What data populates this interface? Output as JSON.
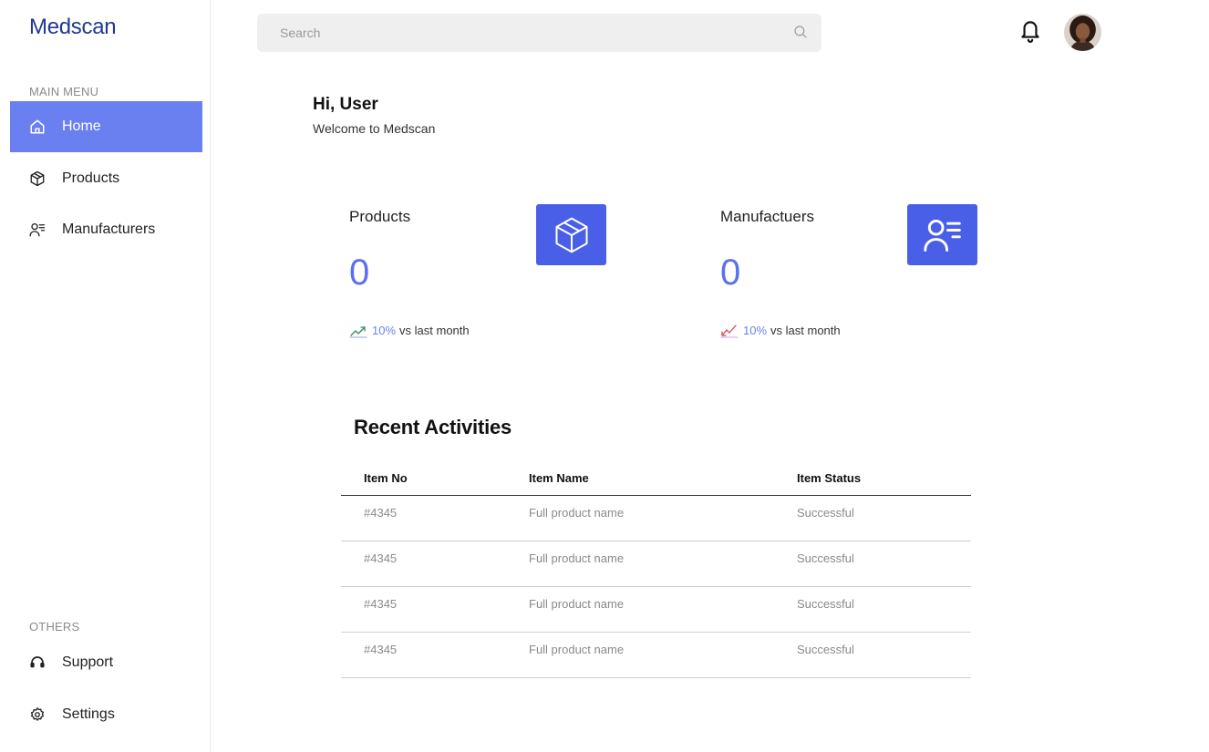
{
  "app": {
    "name": "Medscan"
  },
  "sidebar": {
    "main_heading": "MAIN MENU",
    "items": [
      {
        "label": "Home",
        "icon": "home-icon",
        "active": true
      },
      {
        "label": "Products",
        "icon": "box-icon",
        "active": false
      },
      {
        "label": "Manufacturers",
        "icon": "user-list-icon",
        "active": false
      }
    ],
    "others_heading": "OTHERS",
    "other_items": [
      {
        "label": "Support",
        "icon": "headset-icon"
      },
      {
        "label": "Settings",
        "icon": "gear-icon"
      }
    ]
  },
  "topbar": {
    "search_placeholder": "Search",
    "search_icon": "search-icon",
    "notification_icon": "bell-icon",
    "avatar_icon": "user-avatar"
  },
  "greeting": {
    "title": "Hi, User",
    "subtitle": "Welcome to Medscan"
  },
  "stats": [
    {
      "label": "Products",
      "value": "0",
      "trend_pct": "10%",
      "trend_text": "vs last month",
      "trend_direction": "up",
      "trend_color": "#2f8a5a",
      "tile_icon": "box-icon",
      "tile_color": "#4a5fe8"
    },
    {
      "label": "Manufactuers",
      "value": "0",
      "trend_pct": "10%",
      "trend_text": "vs last month",
      "trend_direction": "down",
      "trend_color": "#e0455a",
      "tile_icon": "user-list-icon",
      "tile_color": "#4a5fe8"
    }
  ],
  "recent": {
    "title": "Recent Activities",
    "columns": [
      "Item No",
      "Item Name",
      "Item Status"
    ],
    "rows": [
      [
        "#4345",
        "Full product name",
        "Successful"
      ],
      [
        "#4345",
        "Full product name",
        "Successful"
      ],
      [
        "#4345",
        "Full product name",
        "Successful"
      ],
      [
        "#4345",
        "Full product name",
        "Successful"
      ]
    ]
  },
  "colors": {
    "accent": "#6a7ff0",
    "brand": "#1f3a93",
    "tile": "#4a5fe8"
  }
}
